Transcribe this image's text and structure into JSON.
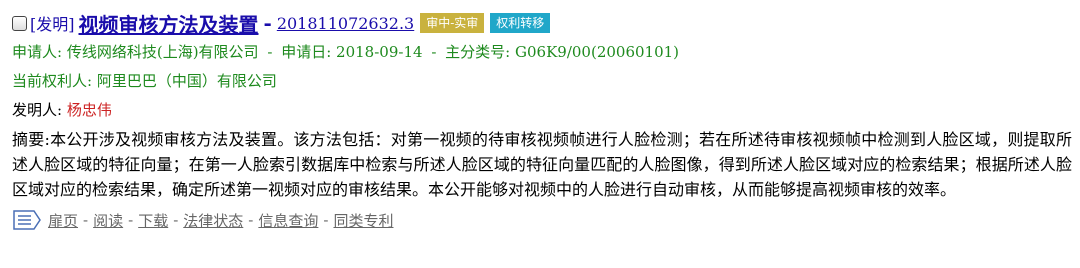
{
  "record": {
    "type_tag": "[发明]",
    "title": "视频审核方法及装置",
    "title_separator": "-",
    "application_number": "201811072632.3",
    "badges": {
      "status": "审中-实审",
      "transfer": "权利转移"
    },
    "applicant_label": "申请人:",
    "applicant": "传线网络科技(上海)有限公司",
    "separator": "-",
    "filing_date_label": "申请日:",
    "filing_date": "2018-09-14",
    "main_class_label": "主分类号:",
    "main_class": "G06K9/00(20060101)",
    "current_owner_label": "当前权利人:",
    "current_owner": "阿里巴巴（中国）有限公司",
    "inventor_label": "发明人:",
    "inventor": "杨忠伟",
    "abstract": "摘要:本公开涉及视频审核方法及装置。该方法包括：对第一视频的待审核视频帧进行人脸检测；若在所述待审核视频帧中检测到人脸区域，则提取所述人脸区域的特征向量；在第一人脸索引数据库中检索与所述人脸区域的特征向量匹配的人脸图像，得到所述人脸区域对应的检索结果；根据所述人脸区域对应的检索结果，确定所述第一视频对应的审核结果。本公开能够对视频中的人脸进行自动审核，从而能够提高视频审核的效率。"
  },
  "actions": {
    "menu_icon": "list-menu-icon",
    "separator": "-",
    "links": [
      "扉页",
      "阅读",
      "下载",
      "法律状态",
      "信息查询",
      "同类专利"
    ]
  },
  "colors": {
    "title_link": "#1a0dab",
    "meta_green": "#1e8a1e",
    "inventor_red": "#cc2222",
    "badge_status": "#c9b23e",
    "badge_transfer": "#20a7c9",
    "action_gray": "#666666"
  }
}
